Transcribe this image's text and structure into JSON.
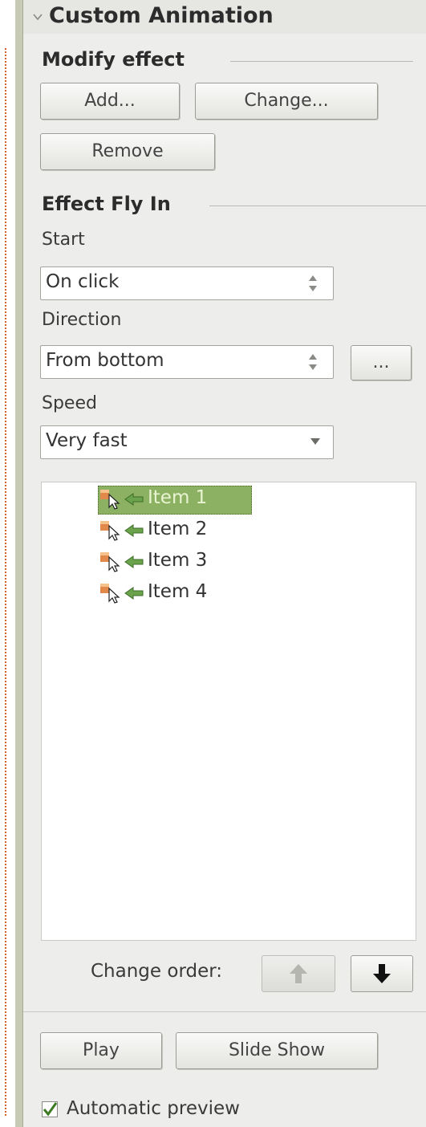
{
  "panel": {
    "title": "Custom Animation",
    "collapse_icon": "chevron-down-icon"
  },
  "modify": {
    "header": "Modify effect",
    "add_label": "Add...",
    "change_label": "Change...",
    "remove_label": "Remove"
  },
  "effect": {
    "header": "Effect Fly In",
    "start_label": "Start",
    "start_value": "On click",
    "direction_label": "Direction",
    "direction_value": "From bottom",
    "options_label": "...",
    "speed_label": "Speed",
    "speed_value": "Very fast"
  },
  "list": {
    "items": [
      {
        "label": "Item 1",
        "selected": true
      },
      {
        "label": "Item 2",
        "selected": false
      },
      {
        "label": "Item 3",
        "selected": false
      },
      {
        "label": "Item 4",
        "selected": false
      }
    ],
    "click_icon": "mouse-click-icon",
    "effect_icon": "fly-in-effect-icon"
  },
  "order": {
    "label": "Change order:",
    "up_icon": "arrow-up-icon",
    "down_icon": "arrow-down-icon"
  },
  "actions": {
    "play_label": "Play",
    "slideshow_label": "Slide Show"
  },
  "preview": {
    "label": "Automatic preview",
    "checked": true
  },
  "colors": {
    "selection": "#8cb162",
    "panel_bg": "#ededeb",
    "frame": "#c7cbb6"
  }
}
